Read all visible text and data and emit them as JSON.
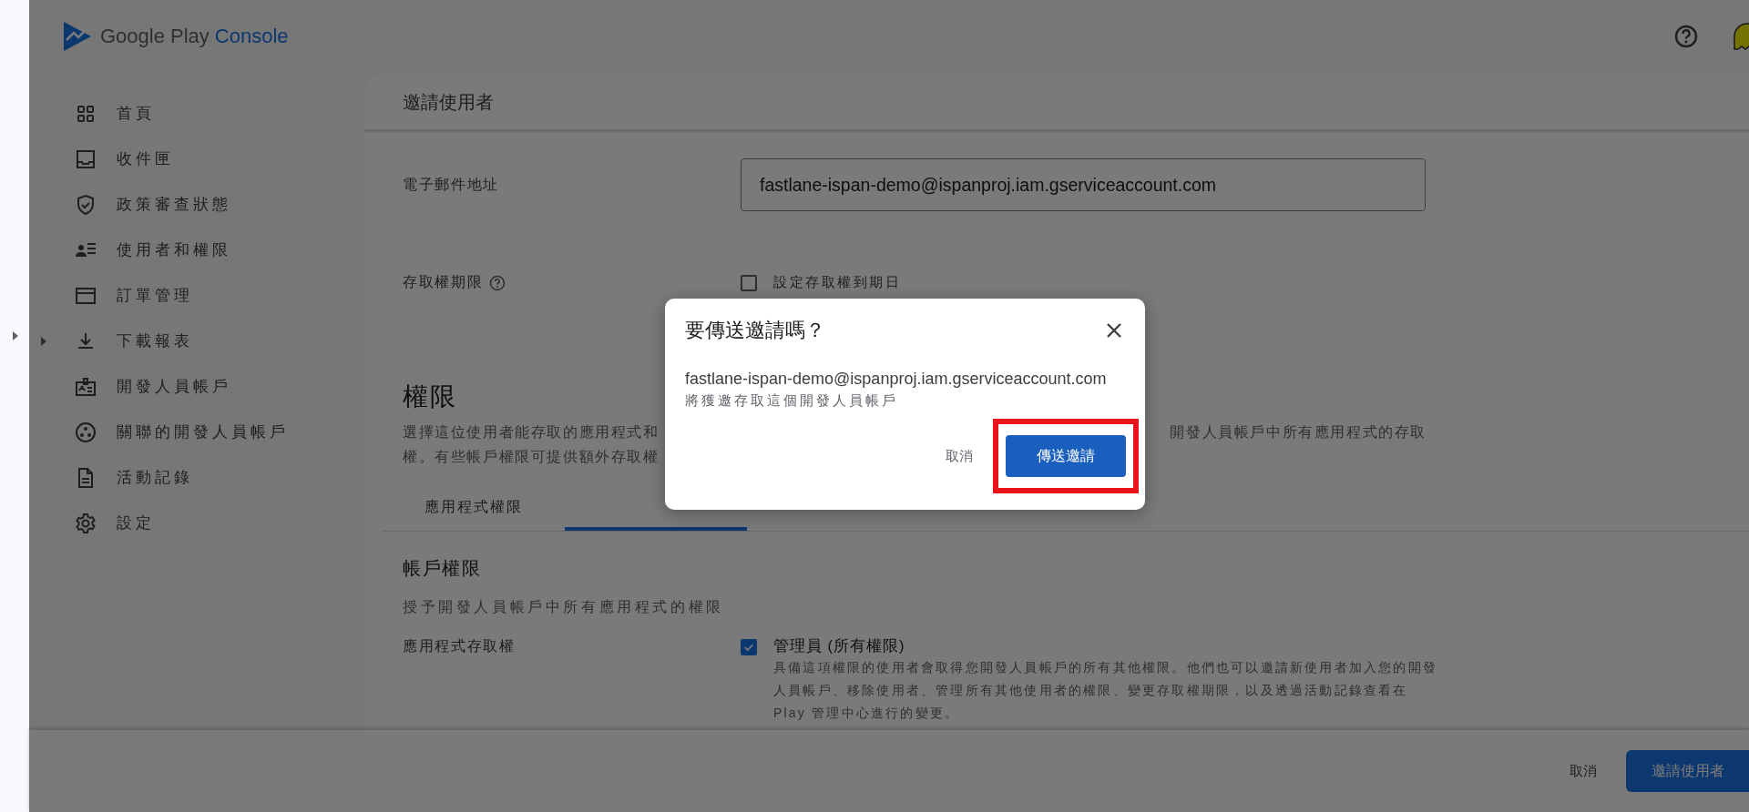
{
  "header": {
    "brand": "Google Play",
    "product": "Console"
  },
  "sidebar": {
    "items": [
      {
        "label": "首頁",
        "kind": "grid",
        "expandable": false
      },
      {
        "label": "收件匣",
        "kind": "inbox",
        "expandable": false
      },
      {
        "label": "政策審查狀態",
        "kind": "shield",
        "expandable": false
      },
      {
        "label": "使用者和權限",
        "kind": "people",
        "expandable": false
      },
      {
        "label": "訂單管理",
        "kind": "card",
        "expandable": false
      },
      {
        "label": "下載報表",
        "kind": "download",
        "expandable": true
      },
      {
        "label": "開發人員帳戶",
        "kind": "badge",
        "expandable": false
      },
      {
        "label": "關聯的開發人員帳戶",
        "kind": "linked",
        "expandable": false
      },
      {
        "label": "活動記錄",
        "kind": "doc",
        "expandable": false
      },
      {
        "label": "設定",
        "kind": "gear",
        "expandable": false
      }
    ]
  },
  "form": {
    "title": "邀請使用者",
    "email_label": "電子郵件地址",
    "email_value": "fastlane-ispan-demo@ispanproj.iam.gserviceaccount.com",
    "expiry_label": "存取權期限",
    "expiry_checkbox": {
      "label": "設定存取權到期日",
      "checked": false
    }
  },
  "permissions": {
    "heading": "權限",
    "description_left": "選擇這位使用者能存取的應用程式和",
    "description_right": "開發人員帳戶中所有應用程式的存取",
    "description_line2": "權。有些帳戶權限可提供額外存取權",
    "tabs": [
      {
        "label": "應用程式權限",
        "selected": false
      },
      {
        "selected": true
      }
    ],
    "section_title": "帳戶權限",
    "section_subtitle": "授予開發人員帳戶中所有應用程式的權限",
    "access_label": "應用程式存取權",
    "options": [
      {
        "label": "管理員 (所有權限)",
        "description": "具備這項權限的使用者會取得您開發人員帳戶的所有其他權限。他們也可以邀請新使用者加入您的開發人員帳戶、移除使用者、管理所有其他使用者的權限、變更存取權期限，以及透過活動記錄查看在 Play 管理中心進行的變更。",
        "checked": true
      }
    ]
  },
  "footer": {
    "cancel": "取消",
    "submit": "邀請使用者"
  },
  "dialog": {
    "title": "要傳送邀請嗎？",
    "email": "fastlane-ispan-demo@ispanproj.iam.gserviceaccount.com",
    "message": "將獲邀存取這個開發人員帳戶",
    "cancel": "取消",
    "confirm": "傳送邀請"
  }
}
